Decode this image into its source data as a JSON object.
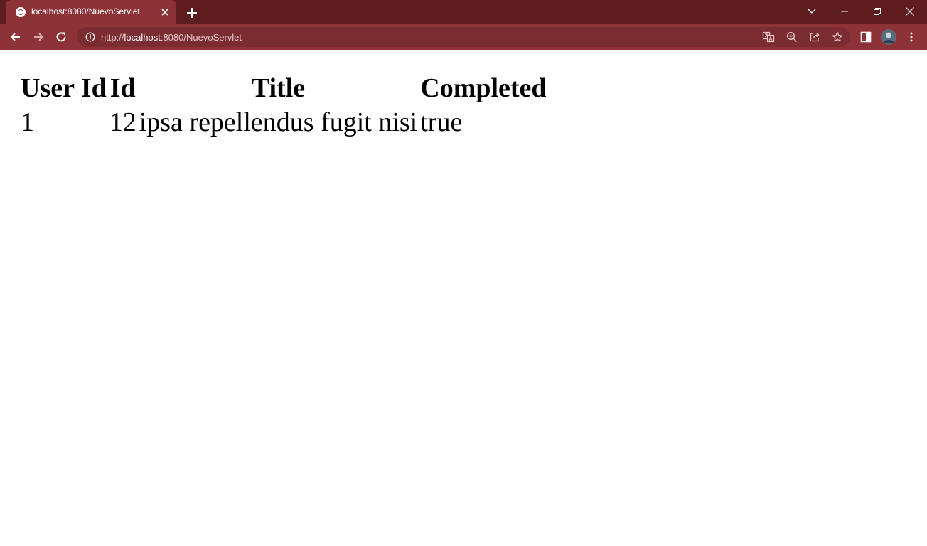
{
  "browser": {
    "tab": {
      "title": "localhost:8080/NuevoServlet",
      "favicon": "globe-icon",
      "close_icon": "close-icon"
    },
    "new_tab_icon": "plus-icon",
    "window_controls": [
      "chevron-down-icon",
      "minimize-icon",
      "restore-icon",
      "close-icon"
    ],
    "toolbar": {
      "back_icon": "back-arrow-icon",
      "forward_icon": "forward-arrow-icon",
      "reload_icon": "reload-icon",
      "url_scheme": "http://",
      "url_host": "localhost",
      "url_rest": ":8080/NuevoServlet",
      "right_icons": [
        "translate-icon",
        "zoom-icon",
        "share-icon",
        "star-icon",
        "side-panel-icon",
        "avatar",
        "kebab-menu-icon"
      ]
    },
    "colors": {
      "titlebar": "#601d20",
      "toolbar": "#8d3236",
      "omnibox": "#7b2c30"
    }
  },
  "page": {
    "table": {
      "headers": [
        "User Id",
        "Id",
        "Title",
        "Completed"
      ],
      "rows": [
        [
          "1",
          "12",
          "ipsa repellendus fugit nisi",
          "true"
        ]
      ]
    }
  }
}
